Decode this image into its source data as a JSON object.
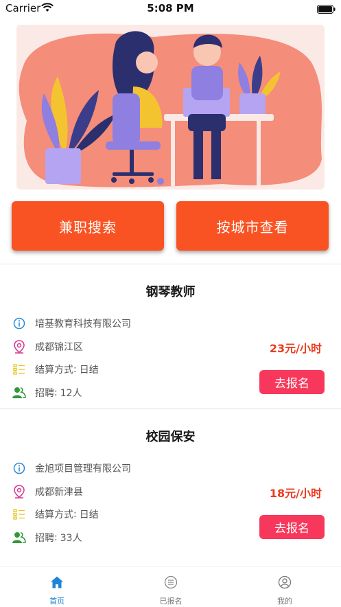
{
  "status_bar": {
    "carrier": "Carrier",
    "time": "5:08 PM"
  },
  "actions": {
    "part_time_search": "兼职搜索",
    "browse_by_city": "按城市查看"
  },
  "labels": {
    "settlement": "结算方式",
    "recruit": "招聘"
  },
  "jobs": [
    {
      "title": "钢琴教师",
      "company": "培基教育科技有限公司",
      "location": "成都锦江区",
      "wage": "23元/小时",
      "settlement": "日结",
      "recruit_count": "12人",
      "apply_label": "去报名"
    },
    {
      "title": "校园保安",
      "company": "金旭项目管理有限公司",
      "location": "成都新津县",
      "wage": "18元/小时",
      "settlement": "日结",
      "recruit_count": "33人",
      "apply_label": "去报名"
    }
  ],
  "tabbar": {
    "items": [
      {
        "label": "首页",
        "icon": "home-icon",
        "active": true
      },
      {
        "label": "已报名",
        "icon": "list-icon",
        "active": false
      },
      {
        "label": "我的",
        "icon": "user-icon",
        "active": false
      }
    ]
  },
  "colors": {
    "primary_orange": "#fa5323",
    "apply_pink": "#f7385c",
    "wage_red": "#ee3a1e",
    "tab_active_blue": "#1f84d6"
  }
}
